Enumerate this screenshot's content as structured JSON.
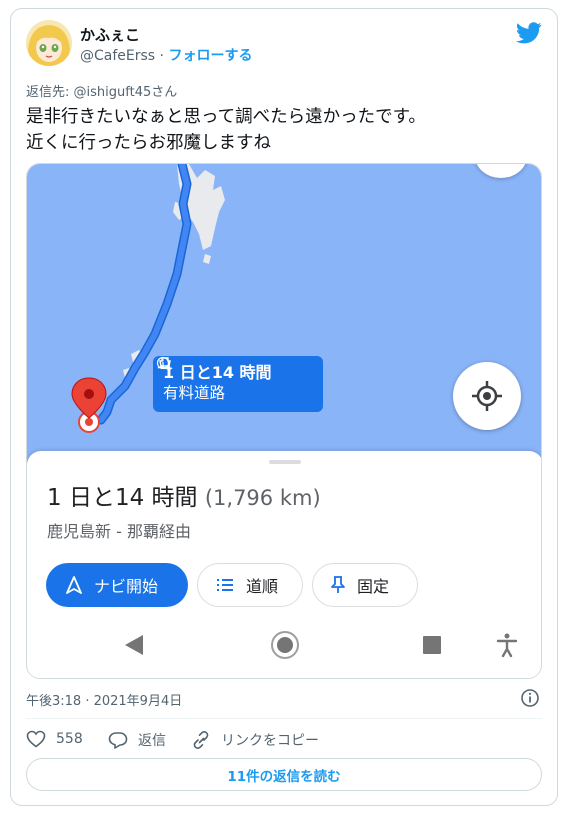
{
  "tweet": {
    "display_name": "かふぇこ",
    "handle": "@CafeErss",
    "separator": " · ",
    "follow_label": "フォローする",
    "reply_to_prefix": "返信先: ",
    "reply_to_handle": "@ishiguft45さん",
    "text_line1": "是非行きたいなぁと思って調べたら遠かったです。",
    "text_line2": "近くに行ったらお邪魔しますね",
    "timestamp": "午後3:18 · 2021年9月4日",
    "like_count": "558",
    "reply_label": "返信",
    "copy_link_label": "リンクをコピー",
    "read_replies_label": "11件の返信を読む"
  },
  "map_screenshot": {
    "bubble_line1": "1 日と14 時間",
    "bubble_line2": "有料道路",
    "duration": "1 日と14 時間",
    "distance": "(1,796 km)",
    "via": "鹿児島新 - 那覇経由",
    "navi_button": "ナビ開始",
    "steps_button": "道順",
    "pin_button": "固定"
  },
  "colors": {
    "twitter_blue": "#1d9bf0",
    "maps_blue": "#1a73e8",
    "sea": "#8ab4f8",
    "pin_red": "#ea4335"
  }
}
